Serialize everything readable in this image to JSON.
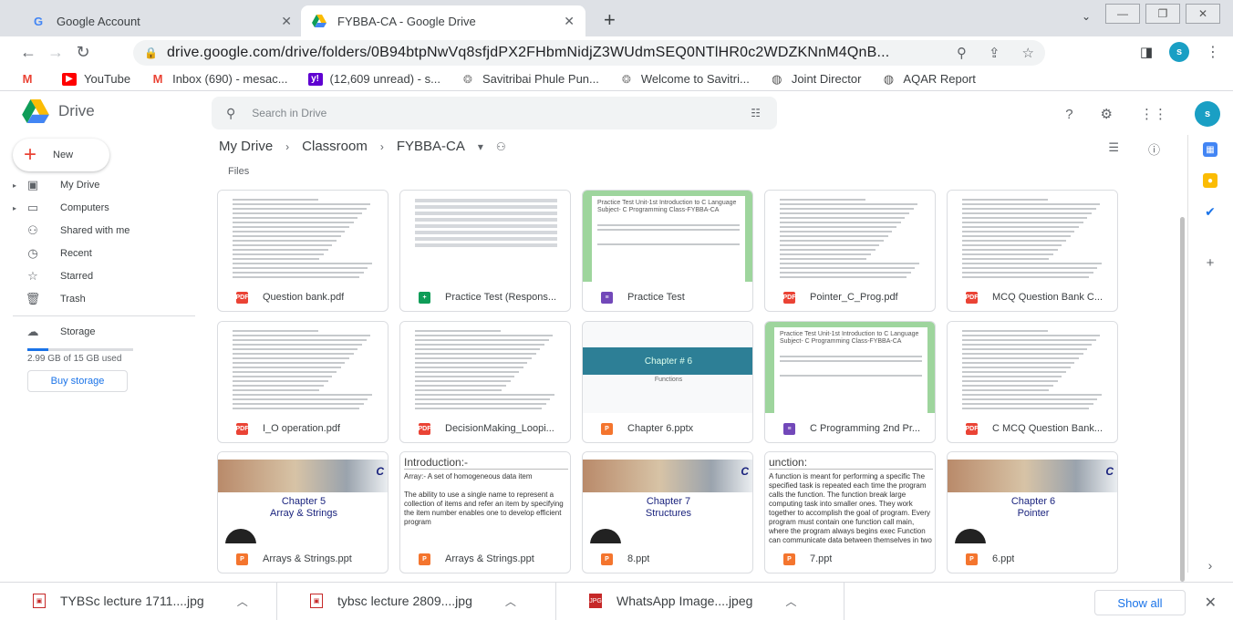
{
  "browser": {
    "tabs": [
      {
        "title": "Google Account",
        "favicon": "G",
        "active": false
      },
      {
        "title": "FYBBA-CA - Google Drive",
        "favicon": "drive",
        "active": true
      }
    ],
    "new_tab": "+",
    "url": "drive.google.com/drive/folders/0B94btpNwVq8sfjdPX2FHbmNidjZ3WUdmSEQ0NTlHR0c2WDZKNnM4QnB...",
    "profile_initial": "s",
    "bookmarks": [
      {
        "label": "",
        "icon": "gmail"
      },
      {
        "label": "YouTube",
        "icon": "youtube"
      },
      {
        "label": "Inbox (690) - mesac...",
        "icon": "gmail"
      },
      {
        "label": "(12,609 unread) - s...",
        "icon": "yahoo"
      },
      {
        "label": "Savitribai Phule Pun...",
        "icon": "university"
      },
      {
        "label": "Welcome to Savitri...",
        "icon": "university"
      },
      {
        "label": "Joint Director",
        "icon": "globe"
      },
      {
        "label": "AQAR Report",
        "icon": "globe"
      }
    ]
  },
  "drive": {
    "app_name": "Drive",
    "search_placeholder": "Search in Drive",
    "profile_initial": "s",
    "new_label": "New",
    "nav": [
      {
        "label": "My Drive",
        "icon": "drive-icon",
        "caret": true
      },
      {
        "label": "Computers",
        "icon": "computer-icon",
        "caret": true
      },
      {
        "label": "Shared with me",
        "icon": "shared-icon",
        "caret": false
      },
      {
        "label": "Recent",
        "icon": "clock-icon",
        "caret": false
      },
      {
        "label": "Starred",
        "icon": "star-icon",
        "caret": false
      },
      {
        "label": "Trash",
        "icon": "trash-icon",
        "caret": false
      }
    ],
    "storage_label": "Storage",
    "storage_used": "2.99 GB of 15 GB used",
    "storage_fraction": 0.2,
    "buy_storage": "Buy storage",
    "breadcrumb": [
      "My Drive",
      "Classroom",
      "FYBBA-CA"
    ],
    "files_label": "Files",
    "files": [
      {
        "name": "Question bank.pdf",
        "type": "pdf",
        "thumb": "doc"
      },
      {
        "name": "Practice Test (Respons...",
        "type": "sheet",
        "thumb": "sheet"
      },
      {
        "name": "Practice Test",
        "type": "form",
        "thumb": "form",
        "thumb_text": "Practice Test Unit-1st Introduction to C Language Subject- C Programming Class-FYBBA-CA"
      },
      {
        "name": "Pointer_C_Prog.pdf",
        "type": "pdf",
        "thumb": "doc"
      },
      {
        "name": "MCQ Question Bank C...",
        "type": "pdf",
        "thumb": "doc"
      },
      {
        "name": "I_O operation.pdf",
        "type": "pdf",
        "thumb": "doc"
      },
      {
        "name": "DecisionMaking_Loopi...",
        "type": "pdf",
        "thumb": "doc"
      },
      {
        "name": "Chapter 6.pptx",
        "type": "ppt",
        "thumb": "chapter",
        "thumb_title": "Chapter # 6",
        "thumb_sub": "Functions"
      },
      {
        "name": "C Programming 2nd Pr...",
        "type": "form",
        "thumb": "form",
        "thumb_text": "Practice Test Unit-1st Introduction to C Language Subject- C Programming Class-FYBBA-CA"
      },
      {
        "name": "C MCQ Question Bank...",
        "type": "pdf",
        "thumb": "doc"
      },
      {
        "name": "Arrays & Strings.ppt",
        "type": "ppt",
        "thumb": "slide",
        "thumb_title": "Chapter 5\nArray & Strings"
      },
      {
        "name": "Arrays & Strings.ppt",
        "type": "ppt",
        "thumb": "text",
        "thumb_head": "Introduction:-",
        "thumb_body": "Array:- A set of homogeneous data item\n\nThe ability to use a single name to represent a collection of items and refer an item by specifying the item number enables one to develop efficient program"
      },
      {
        "name": "8.ppt",
        "type": "ppt",
        "thumb": "slide",
        "thumb_title": "Chapter 7\nStructures"
      },
      {
        "name": "7.ppt",
        "type": "ppt",
        "thumb": "text",
        "thumb_head": "unction:",
        "thumb_body": "A function is meant for performing a specific The specified task is repeated each time the program calls the function. The function break large computing task into smaller ones. They work together to accomplish the goal of program. Every program must contain one function call main, where the program always begins exec Function can communicate data between themselves in two ways."
      },
      {
        "name": "6.ppt",
        "type": "ppt",
        "thumb": "slide",
        "thumb_title": "Chapter 6\nPointer"
      }
    ]
  },
  "downloads": [
    {
      "name": "TYBSc lecture 1711....jpg"
    },
    {
      "name": "tybsc lecture 2809....jpg"
    },
    {
      "name": "WhatsApp Image....jpeg"
    }
  ],
  "show_all": "Show all",
  "colors": {
    "accent": "#1a73e8",
    "pdf": "#ea4335",
    "sheet": "#0f9d58",
    "form": "#7248b9",
    "ppt": "#f4752e"
  }
}
